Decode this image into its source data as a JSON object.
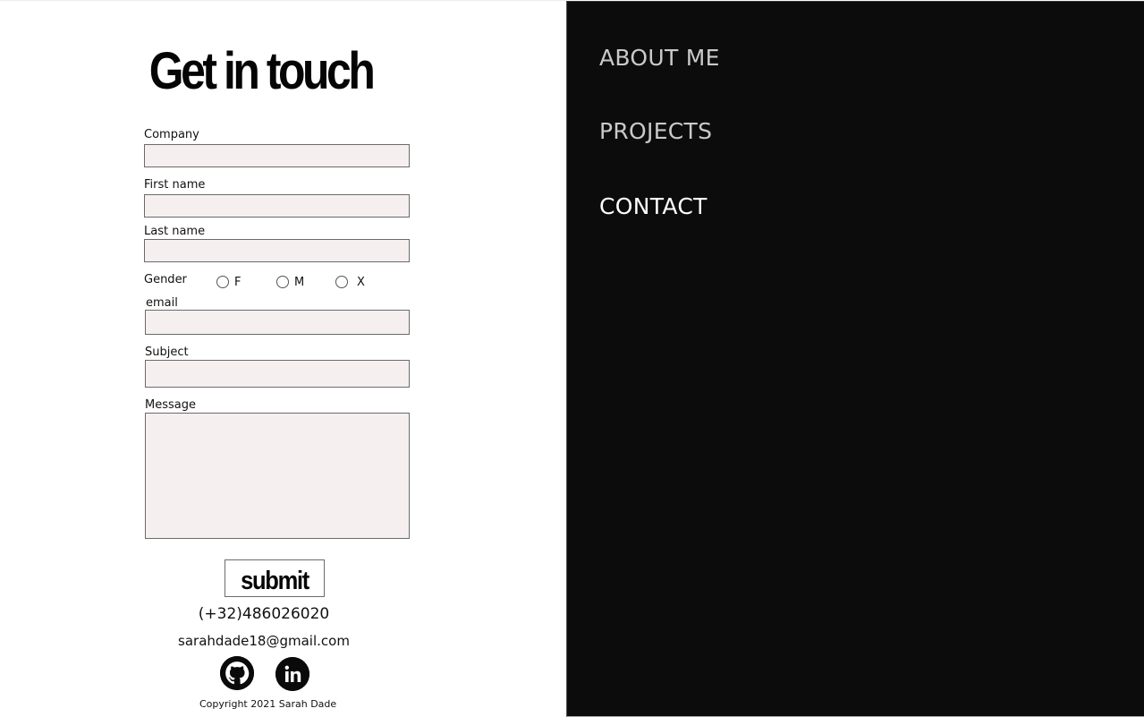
{
  "form": {
    "title": "Get in touch",
    "company_label": "Company",
    "company_value": "",
    "first_name_label": "First name",
    "first_name_value": "",
    "last_name_label": "Last name",
    "last_name_value": "",
    "gender_label": "Gender",
    "gender_options": [
      "F",
      "M",
      "X"
    ],
    "email_label": "email",
    "email_value": "",
    "subject_label": "Subject",
    "subject_value": "",
    "message_label": "Message",
    "message_value": "",
    "submit_label": "submit"
  },
  "contact": {
    "phone": "(+32)486026020",
    "email": "sarahdade18@gmail.com",
    "social_icons": [
      "github-icon",
      "linkedin-icon"
    ],
    "copyright": "Copyright 2021  Sarah Dade"
  },
  "nav": {
    "items": [
      {
        "label": "ABOUT ME",
        "active": false
      },
      {
        "label": "PROJECTS",
        "active": false
      },
      {
        "label": "CONTACT",
        "active": true
      }
    ]
  },
  "colors": {
    "panel_background": "#0c0c0c",
    "input_background": "#f6eff0",
    "nav_inactive": "#c9c9c9",
    "nav_active": "#ffffff"
  }
}
